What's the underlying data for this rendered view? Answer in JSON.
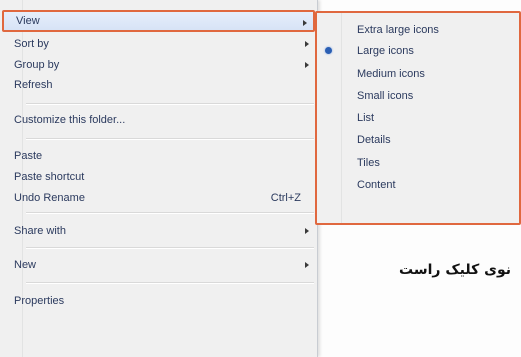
{
  "context_menu": {
    "items": [
      {
        "label": "View",
        "shortcut": "",
        "submenu": true
      },
      {
        "label": "Sort by",
        "shortcut": "",
        "submenu": true
      },
      {
        "label": "Group by",
        "shortcut": "",
        "submenu": true
      },
      {
        "label": "Refresh",
        "shortcut": "",
        "submenu": false
      },
      {
        "label": "Customize this folder...",
        "shortcut": "",
        "submenu": false
      },
      {
        "label": "Paste",
        "shortcut": "",
        "submenu": false
      },
      {
        "label": "Paste shortcut",
        "shortcut": "",
        "submenu": false
      },
      {
        "label": "Undo Rename",
        "shortcut": "Ctrl+Z",
        "submenu": false
      },
      {
        "label": "Share with",
        "shortcut": "",
        "submenu": true
      },
      {
        "label": "New",
        "shortcut": "",
        "submenu": true
      },
      {
        "label": "Properties",
        "shortcut": "",
        "submenu": false
      }
    ]
  },
  "view_submenu": {
    "items": [
      {
        "label": "Extra large icons"
      },
      {
        "label": "Large icons"
      },
      {
        "label": "Medium icons"
      },
      {
        "label": "Small icons"
      },
      {
        "label": "List"
      },
      {
        "label": "Details"
      },
      {
        "label": "Tiles"
      },
      {
        "label": "Content"
      }
    ],
    "selected_item": "Large icons"
  },
  "caption": {
    "text": "نوی کلیک راست"
  },
  "colors": {
    "highlight_border": "#e0683f",
    "menu_background": "#f0f0f0",
    "menu_text": "#2b3a5e"
  }
}
